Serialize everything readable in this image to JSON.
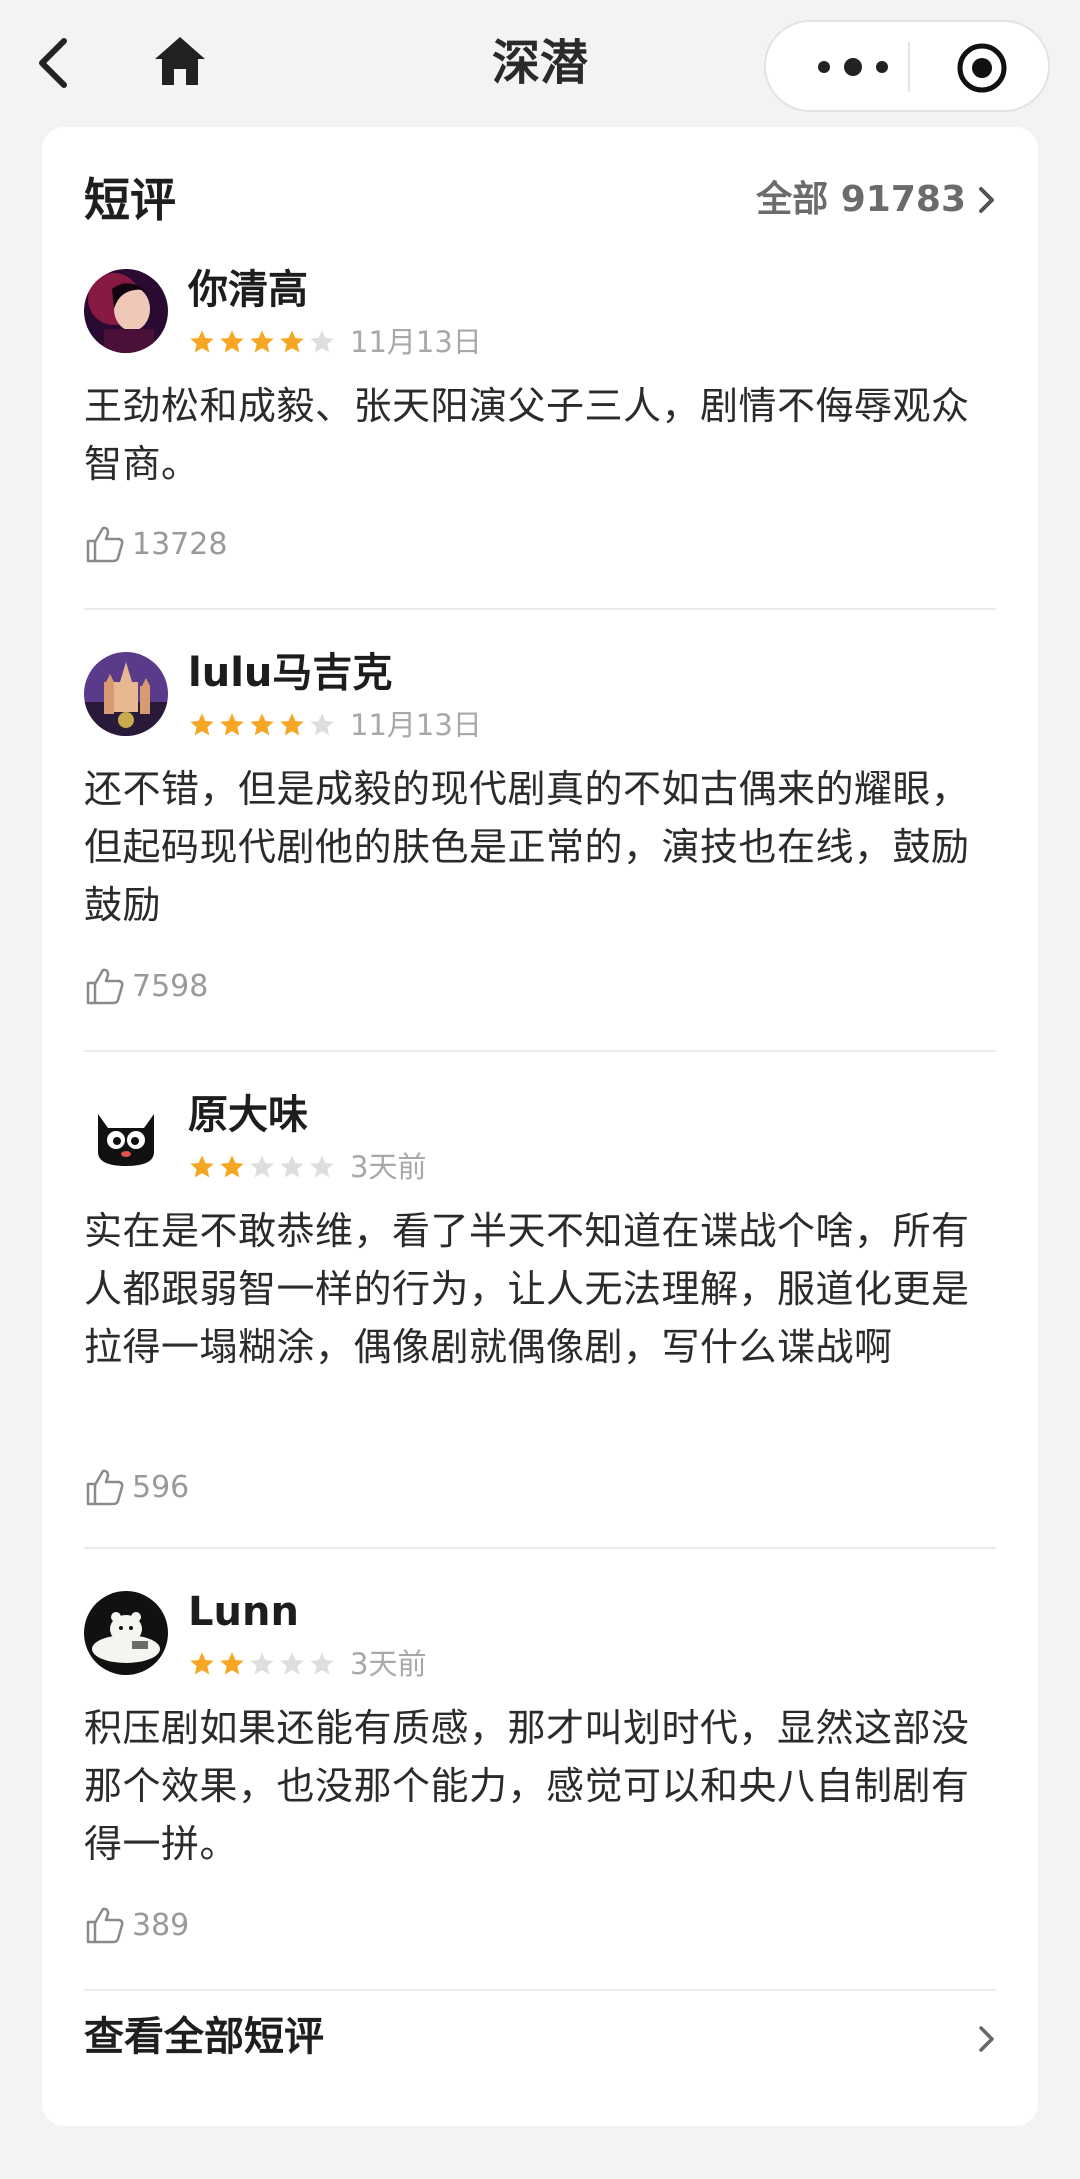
{
  "nav": {
    "title": "深潜",
    "back_icon": "chevron-left-icon",
    "home_icon": "home-icon",
    "menu_icon": "more-dots-icon",
    "close_icon": "target-circle-icon"
  },
  "section": {
    "title": "短评",
    "all_label": "全部 91783"
  },
  "reviews": [
    {
      "name": "你清高",
      "rating": 4,
      "date": "11月13日",
      "text": "王劲松和成毅、张天阳演父子三人，剧情不侮辱观众智商。",
      "likes": "13728"
    },
    {
      "name": "lulu马吉克",
      "rating": 4,
      "date": "11月13日",
      "text": "还不错，但是成毅的现代剧真的不如古偶来的耀眼，但起码现代剧他的肤色是正常的，演技也在线，鼓励鼓励",
      "likes": "7598"
    },
    {
      "name": "原大味",
      "rating": 2,
      "date": "3天前",
      "text": "实在是不敢恭维，看了半天不知道在谍战个啥，所有人都跟弱智一样的行为，让人无法理解，服道化更是拉得一塌糊涂，偶像剧就偶像剧，写什么谍战啊",
      "likes": "596"
    },
    {
      "name": "Lunn",
      "rating": 2,
      "date": "3天前",
      "text": "积压剧如果还能有质感，那才叫划时代，显然这部没那个效果，也没那个能力，感觉可以和央八自制剧有得一拼。",
      "likes": "389"
    }
  ],
  "footer": {
    "view_all_label": "查看全部短评"
  },
  "colors": {
    "star_on": "#f5a623",
    "star_off": "#dedede",
    "background": "#f2f4f3"
  }
}
